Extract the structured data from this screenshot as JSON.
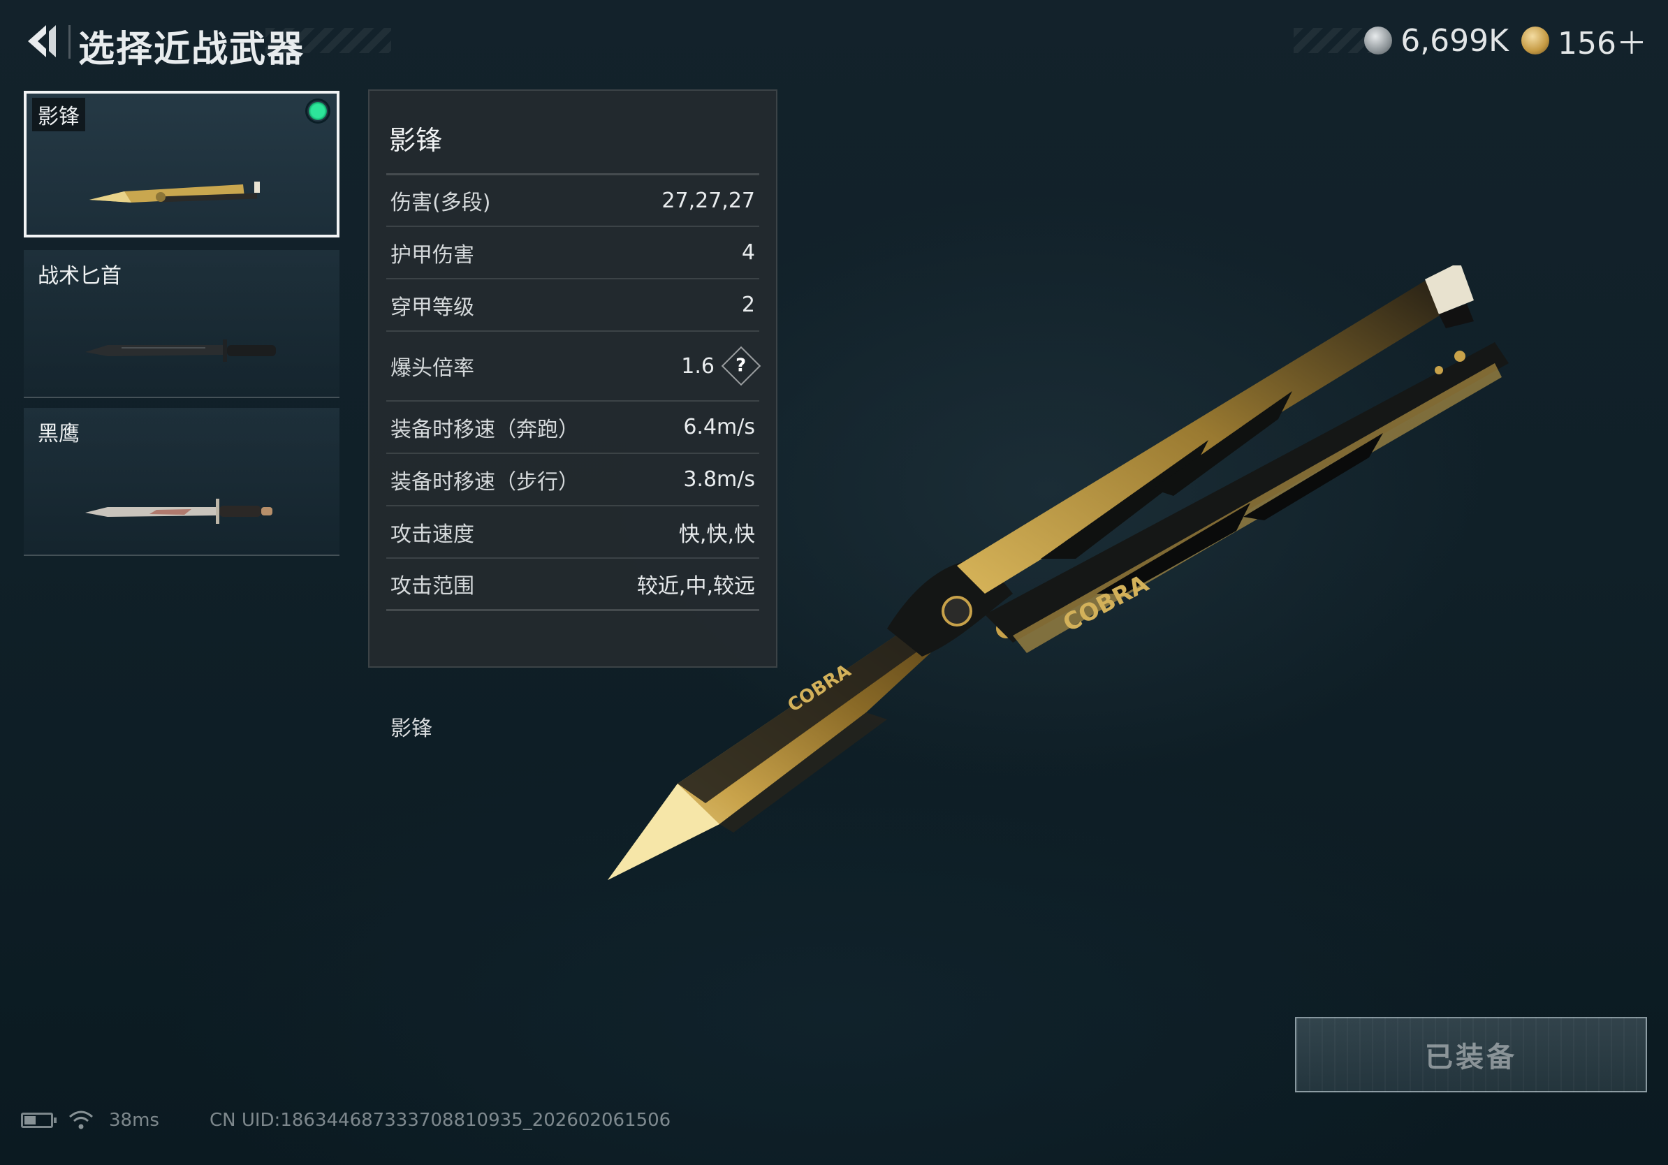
{
  "header": {
    "title": "选择近战武器",
    "currency_silver": "6,699K",
    "currency_gold": "156＋"
  },
  "weapons": [
    {
      "name": "影锋",
      "selected": true,
      "equipped": true
    },
    {
      "name": "战术匕首",
      "selected": false,
      "equipped": false
    },
    {
      "name": "黑鹰",
      "selected": false,
      "equipped": false
    }
  ],
  "stats": {
    "title": "影锋",
    "rows": [
      {
        "label": "伤害(多段)",
        "value": "27,27,27"
      },
      {
        "label": "护甲伤害",
        "value": "4"
      },
      {
        "label": "穿甲等级",
        "value": "2"
      },
      {
        "label": "爆头倍率",
        "value": "1.6"
      },
      {
        "label": "装备时移速（奔跑）",
        "value": "6.4m/s"
      },
      {
        "label": "装备时移速（步行）",
        "value": "3.8m/s"
      },
      {
        "label": "攻击速度",
        "value": "快,快,快"
      },
      {
        "label": "攻击范围",
        "value": "较近,中,较远"
      }
    ],
    "help_symbol": "?",
    "footer": "影锋"
  },
  "equip_button": {
    "label": "已装备"
  },
  "status": {
    "ping": "38ms",
    "uid": "CN UID:1863446873337088109​35_202602061506",
    "battery_level": 0.45
  },
  "knife_decal": {
    "text": "COBRA"
  },
  "colors": {
    "accent_green": "#2de59a",
    "gold": "#c8a24a",
    "panel_bg": "#242a2e"
  }
}
